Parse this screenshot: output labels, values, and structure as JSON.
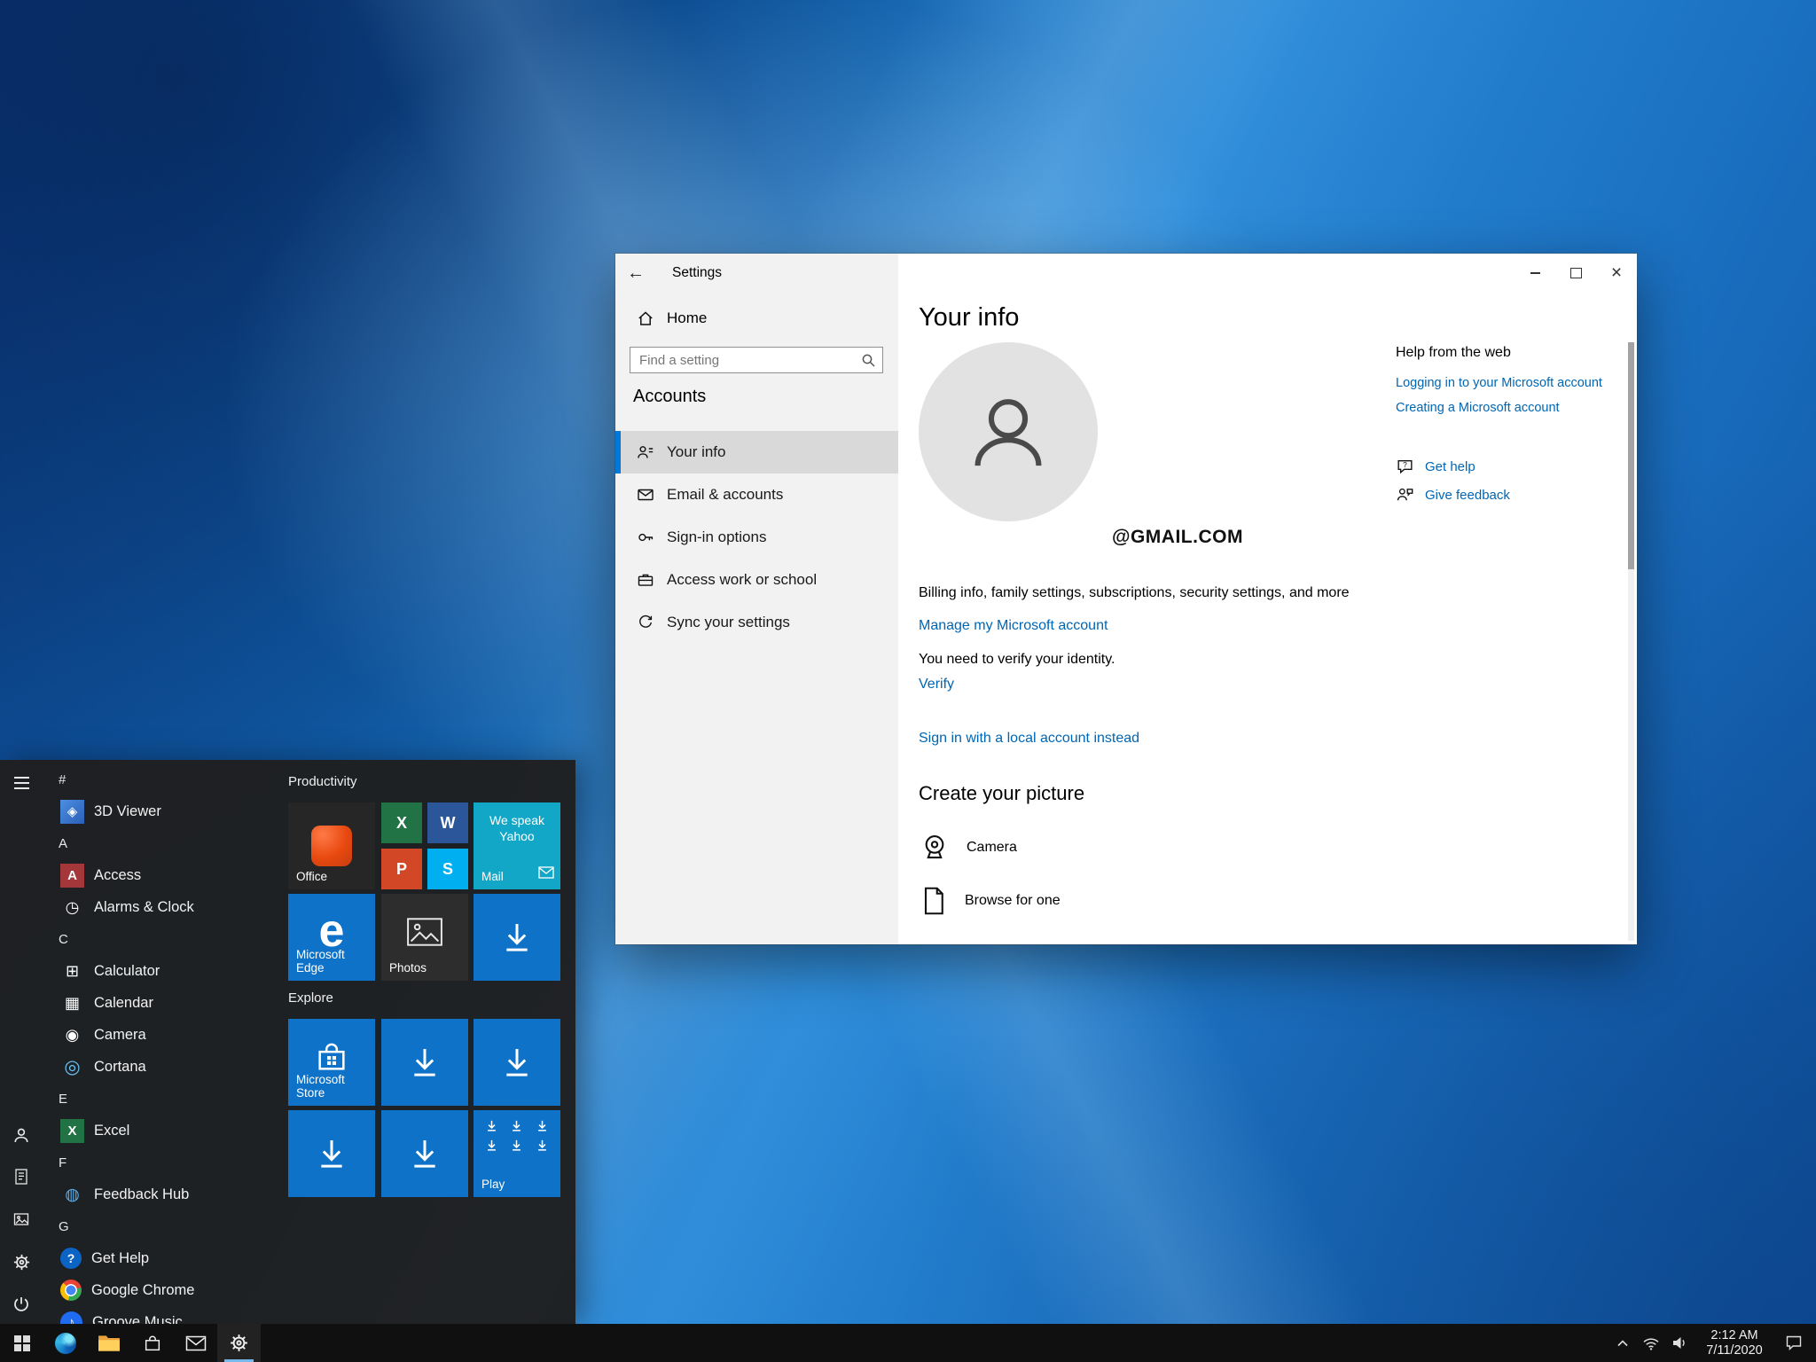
{
  "colors": {
    "accent": "#0078d7",
    "link_blue": "#0066b4",
    "tile_blue": "#0d72c8",
    "taskbar_bg": "#101010",
    "start_menu_bg": "#1f1f1f",
    "sidebar_bg": "#f2f2f2"
  },
  "settings_window": {
    "title": "Settings",
    "icons": {
      "back": "←",
      "close": "×"
    },
    "sidebar": {
      "home": "Home",
      "search_placeholder": "Find a setting",
      "section": "Accounts",
      "items": [
        "Your info",
        "Email & accounts",
        "Sign-in options",
        "Access work or school",
        "Sync your settings"
      ]
    },
    "content": {
      "heading": "Your info",
      "account_email": "@GMAIL.COM",
      "billing_text": "Billing info, family settings, subscriptions, security settings, and more",
      "manage_link": "Manage my Microsoft account",
      "verify_text": "You need to verify your identity.",
      "verify_link": "Verify",
      "local_account_link": "Sign in with a local account instead",
      "create_picture_heading": "Create your picture",
      "camera_label": "Camera",
      "browse_label": "Browse for one"
    },
    "help": {
      "heading": "Help from the web",
      "links": [
        "Logging in to your Microsoft account",
        "Creating a Microsoft account"
      ],
      "get_help": "Get help",
      "give_feedback": "Give feedback"
    }
  },
  "start_menu": {
    "app_list": [
      {
        "type": "header",
        "label": "#"
      },
      {
        "type": "app",
        "label": "3D Viewer",
        "glyph": "◈"
      },
      {
        "type": "header",
        "label": "A"
      },
      {
        "type": "app",
        "label": "Access",
        "glyph": "A"
      },
      {
        "type": "app",
        "label": "Alarms & Clock",
        "glyph": "◷"
      },
      {
        "type": "header",
        "label": "C"
      },
      {
        "type": "app",
        "label": "Calculator",
        "glyph": "⊞"
      },
      {
        "type": "app",
        "label": "Calendar",
        "glyph": "▦"
      },
      {
        "type": "app",
        "label": "Camera",
        "glyph": "◉"
      },
      {
        "type": "app",
        "label": "Cortana",
        "glyph": "◎"
      },
      {
        "type": "header",
        "label": "E"
      },
      {
        "type": "app",
        "label": "Excel",
        "glyph": "X"
      },
      {
        "type": "header",
        "label": "F"
      },
      {
        "type": "app",
        "label": "Feedback Hub",
        "glyph": "◍"
      },
      {
        "type": "header",
        "label": "G"
      },
      {
        "type": "app",
        "label": "Get Help",
        "glyph": "?"
      },
      {
        "type": "app",
        "label": "Google Chrome",
        "glyph": ""
      },
      {
        "type": "app",
        "label": "Groove Music",
        "glyph": "♪"
      }
    ],
    "groups": {
      "productivity": "Productivity",
      "explore": "Explore"
    },
    "tiles": {
      "office": {
        "label": "Office"
      },
      "office_group": {
        "apps": [
          "X",
          "W",
          "P",
          "S"
        ]
      },
      "mail": {
        "label": "Mail",
        "live_text": "We speak Yahoo"
      },
      "edge": {
        "label": "Microsoft Edge",
        "glyph": "e"
      },
      "photos": {
        "label": "Photos"
      },
      "store": {
        "label": "Microsoft Store"
      },
      "play": {
        "label": "Play"
      }
    }
  },
  "taskbar": {
    "apps": [
      "start",
      "edge",
      "file-explorer",
      "store",
      "mail",
      "settings"
    ],
    "clock": {
      "time": "2:12 AM",
      "date": "7/11/2020"
    }
  }
}
